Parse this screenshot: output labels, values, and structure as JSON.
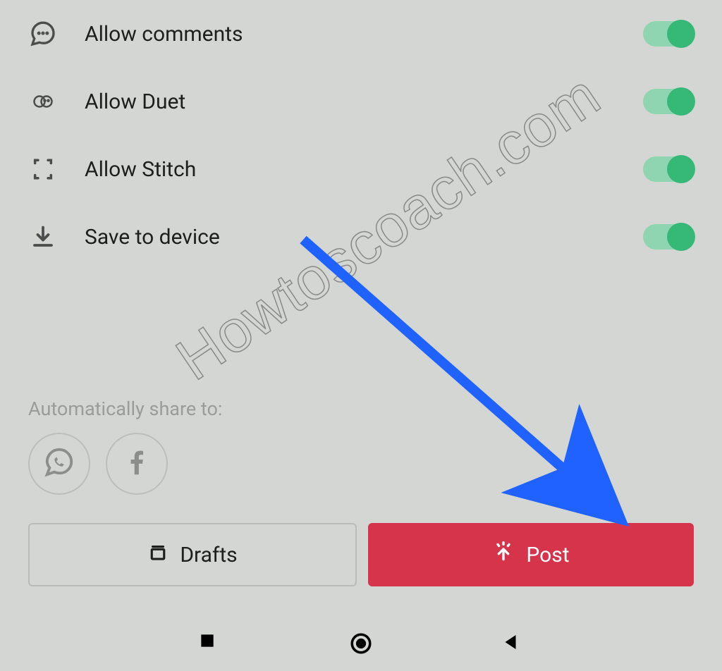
{
  "settings": [
    {
      "key": "allow-comments",
      "label": "Allow comments",
      "on": true
    },
    {
      "key": "allow-duet",
      "label": "Allow Duet",
      "on": true
    },
    {
      "key": "allow-stitch",
      "label": "Allow Stitch",
      "on": true
    },
    {
      "key": "save-to-device",
      "label": "Save to device",
      "on": true
    }
  ],
  "share": {
    "heading": "Automatically share to:",
    "targets": [
      "whatsapp",
      "facebook"
    ]
  },
  "buttons": {
    "drafts": "Drafts",
    "post": "Post"
  },
  "watermark": "Howtoscoach.com",
  "colors": {
    "toggle_track": "#90d5b1",
    "toggle_knob": "#36b877",
    "post_button": "#d6344a",
    "arrow": "#1f62ff"
  }
}
